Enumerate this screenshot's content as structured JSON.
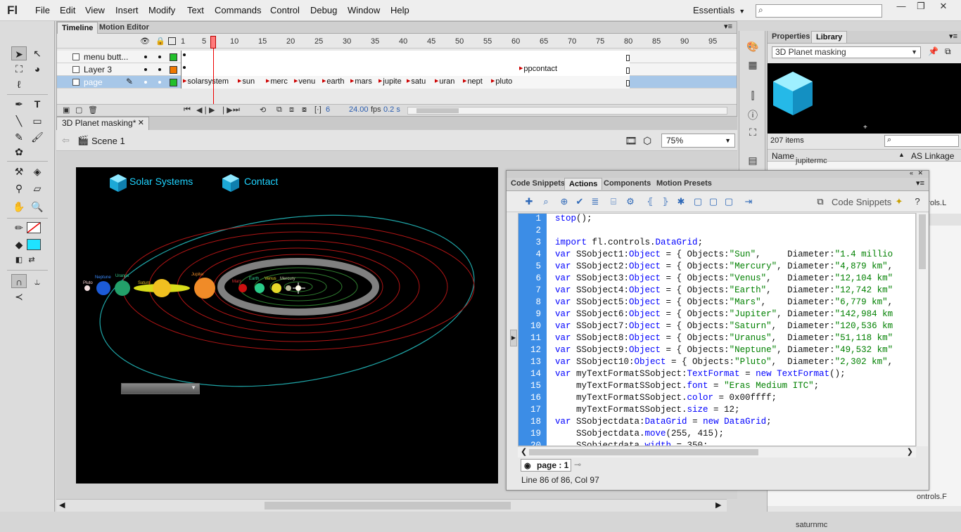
{
  "app": {
    "logo": "Fl"
  },
  "menu": [
    "File",
    "Edit",
    "View",
    "Insert",
    "Modify",
    "Text",
    "Commands",
    "Control",
    "Debug",
    "Window",
    "Help"
  ],
  "workspace": "Essentials",
  "window_buttons": [
    "—",
    "❐",
    "✕"
  ],
  "timeline": {
    "tabs": [
      "Timeline",
      "Motion Editor"
    ],
    "frame_numbers": [
      "1",
      "5",
      "10",
      "15",
      "20",
      "25",
      "30",
      "35",
      "40",
      "45",
      "50",
      "55",
      "60",
      "65",
      "70",
      "75",
      "80",
      "85",
      "90",
      "95"
    ],
    "layers": [
      {
        "name": "menu butt...",
        "color": "#22c02b"
      },
      {
        "name": "Layer 3",
        "color": "#f07800"
      },
      {
        "name": "page",
        "color": "#22c02b"
      }
    ],
    "layer3_label": "ppcontact",
    "page_labels": [
      "solarsystem",
      "sun",
      "merc",
      "venu",
      "earth",
      "mars",
      "jupite",
      "satu",
      "uran",
      "nept",
      "pluto"
    ],
    "current_frame": "6",
    "fps": "24.00",
    "fps_unit": "fps",
    "time": "0.2 s"
  },
  "document": {
    "tab": "3D Planet masking*",
    "scene": "Scene 1",
    "zoom": "75%"
  },
  "stage": {
    "nav": [
      "Solar Systems",
      "Contact"
    ],
    "planet_labels": [
      "Pluto",
      "Neptune",
      "Uranus",
      "Saturn",
      "Jupiter",
      "Mars",
      "Earth",
      "Venus",
      "Mercury"
    ]
  },
  "library": {
    "tabs": [
      "Properties",
      "Library"
    ],
    "document": "3D Planet masking",
    "count": "207 items",
    "col_name": "Name",
    "col_linkage": "AS Linkage",
    "rows": [
      {
        "name": "jupitermc",
        "linkage": ""
      },
      {
        "name": "",
        "linkage": "ontrols.L"
      },
      {
        "name": "",
        "linkage": "ontrols.F"
      },
      {
        "name": "saturnmc",
        "linkage": ""
      }
    ]
  },
  "actions": {
    "tabs": [
      "Code Snippets",
      "Actions",
      "Components",
      "Motion Presets"
    ],
    "snippets_link": "Code Snippets",
    "script_tab": "page : 1",
    "status": "Line 86 of 86, Col 97",
    "code": [
      {
        "n": "1",
        "t": "stop();"
      },
      {
        "n": "2",
        "t": ""
      },
      {
        "n": "3",
        "t": "import fl.controls.DataGrid;"
      },
      {
        "n": "4",
        "t": "var SSobject1:Object = { Objects:\"Sun\",     Diameter:\"1.4 millio"
      },
      {
        "n": "5",
        "t": "var SSobject2:Object = { Objects:\"Mercury\", Diameter:\"4,879 km\","
      },
      {
        "n": "6",
        "t": "var SSobject3:Object = { Objects:\"Venus\",   Diameter:\"12,104 km\""
      },
      {
        "n": "7",
        "t": "var SSobject4:Object = { Objects:\"Earth\",   Diameter:\"12,742 km\""
      },
      {
        "n": "8",
        "t": "var SSobject5:Object = { Objects:\"Mars\",    Diameter:\"6,779 km\","
      },
      {
        "n": "9",
        "t": "var SSobject6:Object = { Objects:\"Jupiter\", Diameter:\"142,984 km"
      },
      {
        "n": "10",
        "t": "var SSobject7:Object = { Objects:\"Saturn\",  Diameter:\"120,536 km"
      },
      {
        "n": "11",
        "t": "var SSobject8:Object = { Objects:\"Uranus\",  Diameter:\"51,118 km\""
      },
      {
        "n": "12",
        "t": "var SSobject9:Object = { Objects:\"Neptune\", Diameter:\"49,532 km\""
      },
      {
        "n": "13",
        "t": "var SSobject10:Object = { Objects:\"Pluto\",  Diameter:\"2,302 km\","
      },
      {
        "n": "14",
        "t": "var myTextFormatSSobject:TextFormat = new TextFormat();"
      },
      {
        "n": "15",
        "t": "    myTextFormatSSobject.font = \"Eras Medium ITC\";"
      },
      {
        "n": "16",
        "t": "    myTextFormatSSobject.color = 0x00ffff;"
      },
      {
        "n": "17",
        "t": "    myTextFormatSSobject.size = 12;"
      },
      {
        "n": "18",
        "t": "var SSobjectdata:DataGrid = new DataGrid;"
      },
      {
        "n": "19",
        "t": "    SSobjectdata.move(255, 415);"
      },
      {
        "n": "20",
        "t": "    SSobjectdata.width = 350;"
      }
    ]
  }
}
